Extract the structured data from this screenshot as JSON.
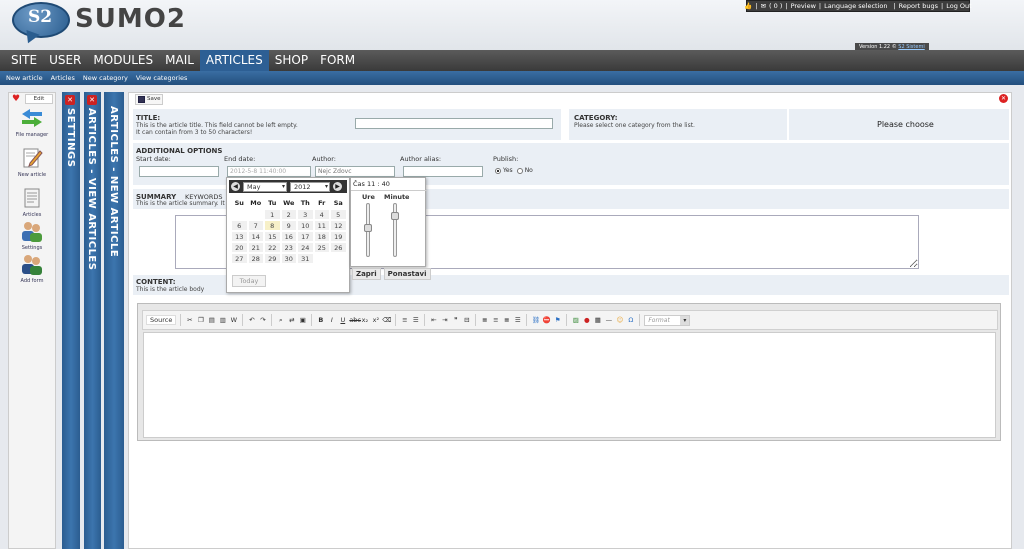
{
  "logo": {
    "mark": "S2",
    "text": "SUMO2"
  },
  "topbar": {
    "counter": "( 0 )",
    "preview": "Preview",
    "language": "Language selection",
    "report": "Report bugs",
    "logout": "Log Out"
  },
  "version": {
    "label": "Version 1.22 ©",
    "company": "S2 Sistemi"
  },
  "mainnav": {
    "items": [
      "SITE",
      "USER",
      "MODULES",
      "MAIL",
      "ARTICLES",
      "SHOP",
      "FORM"
    ],
    "active": "ARTICLES"
  },
  "subnav": {
    "items": [
      "New article",
      "Articles",
      "New category",
      "View categories"
    ]
  },
  "leftpanel": {
    "edit": "Edit",
    "items": [
      "File manager",
      "New article",
      "Articles",
      "Settings",
      "Add form"
    ]
  },
  "vtabs": [
    "SETTINGS",
    "ARTICLES - VIEW ARTICLES",
    "ARTICLES - NEW ARTICLE"
  ],
  "toolbar": {
    "save": "Save"
  },
  "form": {
    "title_label": "TITLE:",
    "title_hint1": "This is the article title. This field cannot be left empty.",
    "title_hint2": "It can contain from 3 to 50 characters!",
    "category_label": "CATEGORY:",
    "category_hint": "Please select one category from the list.",
    "category_value": "Please choose",
    "additional_label": "ADDITIONAL OPTIONS",
    "start_date": "Start date:",
    "end_date": "End date:",
    "end_date_value": "2012-5-8 11:40:00",
    "author": "Author:",
    "author_placeholder": "Nejc Zdovc",
    "author_alias": "Author alias:",
    "publish": "Publish:",
    "yes": "Yes",
    "no": "No",
    "summary_tab": "SUMMARY",
    "keywords_tab": "KEYWORDS",
    "summary_hint": "This is the article summary. It",
    "content_label": "CONTENT:",
    "content_hint": "This is the article body"
  },
  "calendar": {
    "month": "May",
    "year": "2012",
    "weekdays": [
      "Su",
      "Mo",
      "Tu",
      "We",
      "Th",
      "Fr",
      "Sa"
    ],
    "weeks": [
      [
        "",
        "",
        "1",
        "2",
        "3",
        "4",
        "5"
      ],
      [
        "6",
        "7",
        "8",
        "9",
        "10",
        "11",
        "12"
      ],
      [
        "13",
        "14",
        "15",
        "16",
        "17",
        "18",
        "19"
      ],
      [
        "20",
        "21",
        "22",
        "23",
        "24",
        "25",
        "26"
      ],
      [
        "27",
        "28",
        "29",
        "30",
        "31",
        "",
        ""
      ]
    ],
    "today": "Today"
  },
  "timepicker": {
    "label": "Čas",
    "time": "11 : 40",
    "hours": "Ure",
    "minutes": "Minute",
    "clear": "Zapri",
    "set": "Ponastavi",
    "hour_level": 0.45,
    "minute_level": 0.2
  },
  "editor": {
    "source": "Source",
    "format": "Format"
  }
}
